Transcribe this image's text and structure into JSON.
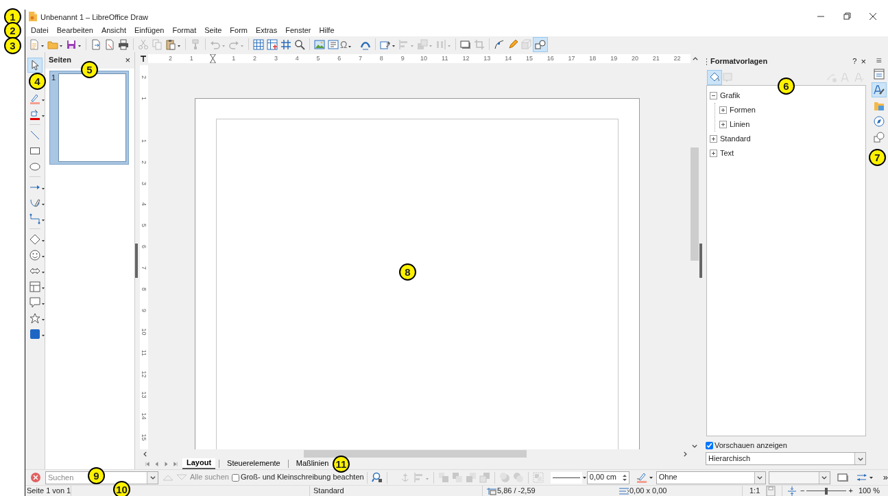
{
  "title_bar": {
    "title": "Unbenannt 1 – LibreOffice Draw"
  },
  "menu": [
    "Datei",
    "Bearbeiten",
    "Ansicht",
    "Einfügen",
    "Format",
    "Seite",
    "Form",
    "Extras",
    "Fenster",
    "Hilfe"
  ],
  "toolbar": [
    {
      "kind": "button",
      "dropdown": true,
      "disabled": false,
      "selected": false
    },
    {
      "kind": "button",
      "dropdown": true,
      "disabled": false,
      "selected": false
    },
    {
      "kind": "button",
      "dropdown": true,
      "disabled": false,
      "selected": false
    },
    {
      "kind": "separator"
    },
    {
      "kind": "button",
      "dropdown": false,
      "disabled": false,
      "selected": false
    },
    {
      "kind": "button",
      "dropdown": false,
      "disabled": false,
      "selected": false
    },
    {
      "kind": "button",
      "dropdown": false,
      "disabled": false,
      "selected": false
    },
    {
      "kind": "separator"
    },
    {
      "kind": "button",
      "dropdown": false,
      "disabled": true,
      "selected": false
    },
    {
      "kind": "button",
      "dropdown": false,
      "disabled": true,
      "selected": false
    },
    {
      "kind": "button",
      "dropdown": true,
      "disabled": false,
      "selected": false
    },
    {
      "kind": "separator"
    },
    {
      "kind": "button",
      "dropdown": false,
      "disabled": true,
      "selected": false
    },
    {
      "kind": "separator"
    },
    {
      "kind": "button",
      "dropdown": true,
      "disabled": true,
      "selected": false
    },
    {
      "kind": "button",
      "dropdown": true,
      "disabled": true,
      "selected": false
    },
    {
      "kind": "separator"
    },
    {
      "kind": "button",
      "dropdown": false,
      "disabled": false,
      "selected": false
    },
    {
      "kind": "button",
      "dropdown": false,
      "disabled": false,
      "selected": false
    },
    {
      "kind": "button",
      "dropdown": false,
      "disabled": false,
      "selected": false
    },
    {
      "kind": "button",
      "dropdown": false,
      "disabled": false,
      "selected": false
    },
    {
      "kind": "separator"
    },
    {
      "kind": "button",
      "dropdown": false,
      "disabled": false,
      "selected": false
    },
    {
      "kind": "button",
      "dropdown": false,
      "disabled": false,
      "selected": false
    },
    {
      "kind": "button",
      "label": "Ω",
      "dropdown": true,
      "disabled": false,
      "selected": false
    },
    {
      "kind": "button",
      "dropdown": false,
      "disabled": false,
      "selected": false
    },
    {
      "kind": "separator"
    },
    {
      "kind": "button",
      "dropdown": true,
      "disabled": false,
      "selected": false
    },
    {
      "kind": "button",
      "dropdown": true,
      "disabled": true,
      "selected": false
    },
    {
      "kind": "button",
      "dropdown": true,
      "disabled": true,
      "selected": false
    },
    {
      "kind": "button",
      "dropdown": true,
      "disabled": true,
      "selected": false
    },
    {
      "kind": "separator"
    },
    {
      "kind": "button",
      "dropdown": false,
      "disabled": false,
      "selected": false
    },
    {
      "kind": "button",
      "dropdown": false,
      "disabled": true,
      "selected": false
    },
    {
      "kind": "separator"
    },
    {
      "kind": "button",
      "dropdown": false,
      "disabled": false,
      "selected": false
    },
    {
      "kind": "button",
      "dropdown": false,
      "disabled": false,
      "selected": false
    },
    {
      "kind": "button",
      "dropdown": false,
      "disabled": true,
      "selected": false
    },
    {
      "kind": "button",
      "dropdown": false,
      "disabled": false,
      "selected": true
    }
  ],
  "drawing_tools": [
    {
      "kind": "button",
      "dropdown": false,
      "disabled": false,
      "selected": true
    },
    {
      "kind": "button",
      "dropdown": true,
      "disabled": false,
      "selected": false
    },
    {
      "kind": "button",
      "dropdown": true,
      "disabled": false,
      "selected": false
    },
    {
      "kind": "separator"
    },
    {
      "kind": "button",
      "dropdown": false,
      "disabled": false,
      "selected": false
    },
    {
      "kind": "button",
      "dropdown": false,
      "disabled": false,
      "selected": false
    },
    {
      "kind": "button",
      "dropdown": false,
      "disabled": false,
      "selected": false
    },
    {
      "kind": "separator"
    },
    {
      "kind": "button",
      "dropdown": true,
      "disabled": false,
      "selected": false
    },
    {
      "kind": "button",
      "dropdown": true,
      "disabled": false,
      "selected": false
    },
    {
      "kind": "button",
      "dropdown": true,
      "disabled": false,
      "selected": false
    },
    {
      "kind": "separator"
    },
    {
      "kind": "button",
      "dropdown": true,
      "disabled": false,
      "selected": false
    },
    {
      "kind": "button",
      "dropdown": true,
      "disabled": false,
      "selected": false
    },
    {
      "kind": "button",
      "dropdown": true,
      "disabled": false,
      "selected": false
    },
    {
      "kind": "button",
      "dropdown": true,
      "disabled": false,
      "selected": false
    },
    {
      "kind": "button",
      "dropdown": true,
      "disabled": false,
      "selected": false
    },
    {
      "kind": "button",
      "dropdown": true,
      "disabled": false,
      "selected": false
    },
    {
      "kind": "button",
      "dropdown": true,
      "disabled": false,
      "selected": false
    }
  ],
  "pages_pane": {
    "title": "Seiten",
    "close": "×",
    "pages": [
      {
        "number": "1",
        "selected": true
      }
    ]
  },
  "rulers": {
    "horizontal": {
      "before": [
        "2",
        "1"
      ],
      "after": [
        "1",
        "2",
        "3",
        "4",
        "5",
        "6",
        "7",
        "8",
        "9",
        "10",
        "11",
        "12",
        "13",
        "14",
        "15",
        "16",
        "17",
        "18",
        "19",
        "20",
        "21",
        "22"
      ]
    },
    "vertical": {
      "before": [
        "2",
        "1"
      ],
      "after": [
        "1",
        "2",
        "3",
        "4",
        "5",
        "6",
        "7",
        "8",
        "9",
        "10",
        "11",
        "12",
        "13",
        "14",
        "15"
      ]
    }
  },
  "layer_tabs": [
    {
      "label": "Layout",
      "selected": true
    },
    {
      "label": "Steuerelemente",
      "selected": false
    },
    {
      "label": "Maßlinien",
      "selected": false
    }
  ],
  "sidebar": {
    "title": "Formatvorlagen",
    "help": "?",
    "close": "×",
    "menu": "≡",
    "tools": [
      {
        "selected": true,
        "disabled": false
      },
      {
        "selected": false,
        "disabled": true
      },
      {
        "selected": false,
        "disabled": true
      },
      {
        "selected": false,
        "disabled": true
      },
      {
        "selected": false,
        "disabled": true
      }
    ],
    "styles": [
      {
        "label": "Grafik",
        "expanded": true,
        "children": [
          {
            "label": "Formen",
            "expanded": false
          },
          {
            "label": "Linien",
            "expanded": false
          }
        ]
      },
      {
        "label": "Standard",
        "expanded": false
      },
      {
        "label": "Text",
        "expanded": false
      }
    ],
    "preview": {
      "label": "Vorschauen anzeigen",
      "checked": true
    },
    "filter": {
      "value": "Hierarchisch"
    },
    "deck_tabs": [
      {
        "selected": false
      },
      {
        "selected": true
      },
      {
        "selected": false
      },
      {
        "selected": false
      },
      {
        "selected": false
      }
    ]
  },
  "find_bar": {
    "placeholder": "Suchen",
    "previous": {
      "disabled": true
    },
    "next": {
      "disabled": true
    },
    "find_all": {
      "label": "Alle suchen",
      "disabled": true
    },
    "match_case": {
      "label": "Groß- und Kleinschreibung beachten",
      "checked": false
    }
  },
  "format_bar": {
    "tools": [
      {
        "kind": "button",
        "dropdown": false,
        "disabled": true
      },
      {
        "kind": "button",
        "dropdown": true,
        "disabled": true
      },
      {
        "kind": "separator"
      },
      {
        "kind": "button",
        "dropdown": false,
        "disabled": true
      },
      {
        "kind": "button",
        "dropdown": false,
        "disabled": true
      },
      {
        "kind": "button",
        "dropdown": false,
        "disabled": true
      },
      {
        "kind": "button",
        "dropdown": false,
        "disabled": true
      },
      {
        "kind": "separator"
      },
      {
        "kind": "button",
        "dropdown": false,
        "disabled": true
      },
      {
        "kind": "button",
        "dropdown": false,
        "disabled": true
      },
      {
        "kind": "separator"
      },
      {
        "kind": "button",
        "dropdown": false,
        "disabled": true
      }
    ],
    "line_width": "0,00 cm",
    "area_style": "Ohne",
    "more": "»"
  },
  "status_bar": {
    "page": "Seite 1 von 1",
    "slide_layout": "Standard",
    "position": "5,86 / -2,59",
    "size": "0,00 x 0,00",
    "scale": "1:1",
    "zoom_out": "−",
    "zoom_in": "+",
    "zoom_slider": {
      "level": 0.5
    },
    "zoom_percent": "100 %"
  },
  "callouts": [
    "1",
    "2",
    "3",
    "4",
    "5",
    "6",
    "7",
    "8",
    "9",
    "10",
    "11"
  ]
}
